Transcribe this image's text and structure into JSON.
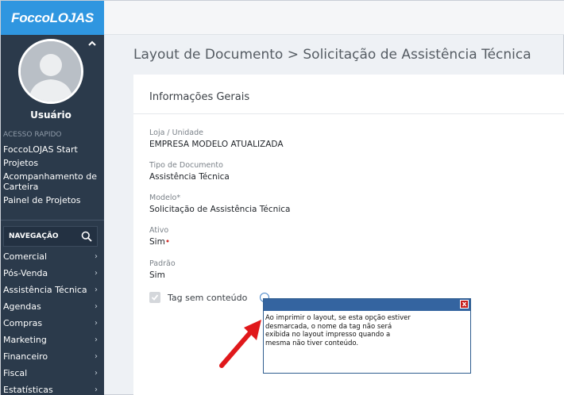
{
  "sidebar": {
    "brand": "FoccoLOJAS",
    "user_name": "Usuário",
    "quick_access_label": "ACESSO RAPIDO",
    "quick_access": [
      "FoccoLOJAS Start",
      "Projetos",
      "Acompanhamento de Carteira",
      "Painel de Projetos"
    ],
    "nav_label": "NAVEGAÇÃO",
    "nav": [
      "Comercial",
      "Pós-Venda",
      "Assistência Técnica",
      "Agendas",
      "Compras",
      "Marketing",
      "Financeiro",
      "Fiscal",
      "Estatísticas"
    ]
  },
  "header": {
    "title": "Layout de Documento > Solicitação de Assistência Técnica"
  },
  "panel": {
    "title": "Informações Gerais",
    "fields": [
      {
        "label": "Loja / Unidade",
        "value": "EMPRESA MODELO ATUALIZADA"
      },
      {
        "label": "Tipo de Documento",
        "value": "Assistência Técnica"
      },
      {
        "label": "Modelo*",
        "value": "Solicitação de Assistência Técnica"
      },
      {
        "label": "Ativo",
        "value": "Sim",
        "required_mark": "•"
      },
      {
        "label": "Padrão",
        "value": "Sim"
      }
    ],
    "checkbox_label": "Tag sem conteúdo"
  },
  "tooltip": {
    "close": "x",
    "text": "Ao imprimir o layout, se esta opção estiver desmarcada, o nome da tag não será exibida no layout impresso quando a mesma não tiver conteúdo."
  },
  "colors": {
    "sidebar_bg": "#2b3a4b",
    "brand_bg": "#2f96e0",
    "tooltip_header": "#3464a0",
    "arrow": "#e0181b"
  }
}
